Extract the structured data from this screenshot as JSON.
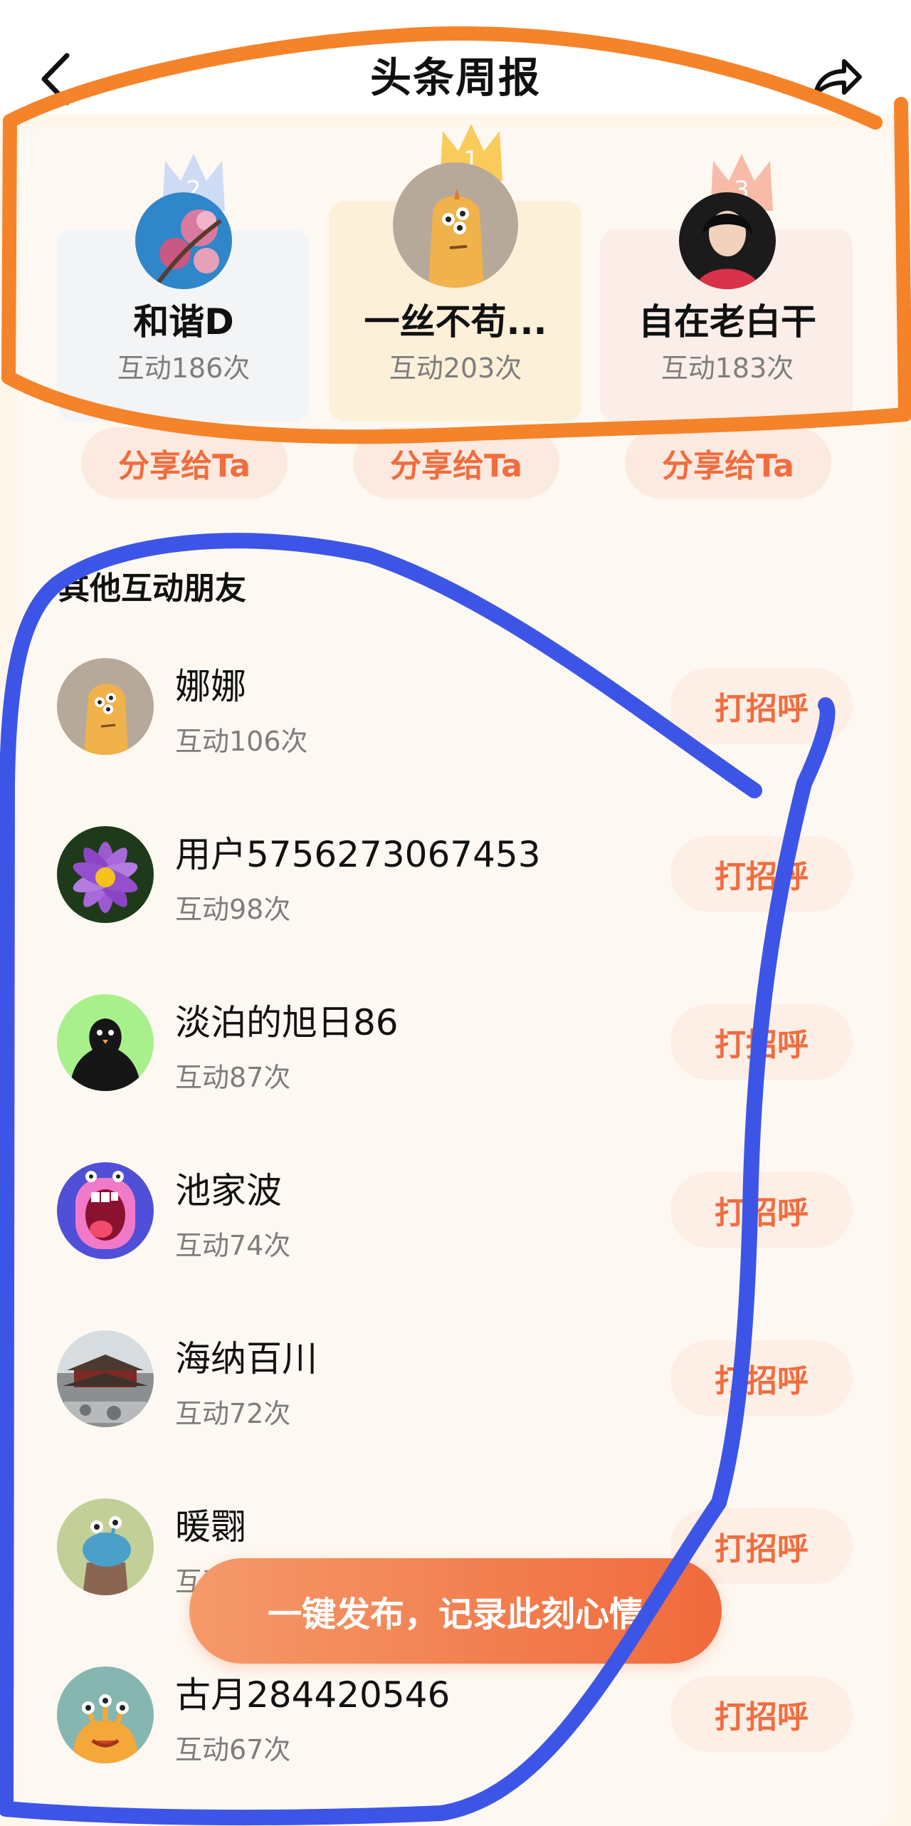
{
  "header": {
    "title": "头条周报",
    "back_icon": "chevron-left-icon",
    "share_icon": "share-arrow-icon"
  },
  "top_friends": [
    {
      "rank": "2",
      "name": "和谐D",
      "count": "互动186次",
      "share_label": "分享给Ta",
      "crown_color": "#b8cdf3"
    },
    {
      "rank": "1",
      "name": "一丝不苟...",
      "count": "互动203次",
      "share_label": "分享给Ta",
      "crown_color": "#f7c54a"
    },
    {
      "rank": "3",
      "name": "自在老白干",
      "count": "互动183次",
      "share_label": "分享给Ta",
      "crown_color": "#f4a890"
    }
  ],
  "section_title": "其他互动朋友",
  "others": [
    {
      "name": "娜娜",
      "count": "互动106次",
      "greet": "打招呼"
    },
    {
      "name": "用户5756273067453",
      "count": "互动98次",
      "greet": "打招呼"
    },
    {
      "name": "淡泊的旭日86",
      "count": "互动87次",
      "greet": "打招呼"
    },
    {
      "name": "池家波",
      "count": "互动74次",
      "greet": "打招呼"
    },
    {
      "name": "海纳百川",
      "count": "互动72次",
      "greet": "打招呼"
    },
    {
      "name": "暖翾",
      "count": "互动70次",
      "greet": "打招呼"
    },
    {
      "name": "古月284420546",
      "count": "互动67次",
      "greet": "打招呼"
    }
  ],
  "publish_button": "一键发布，记录此刻心情",
  "colors": {
    "accent": "#ef6d3e",
    "highlight_orange": "#f5832a",
    "highlight_blue": "#3d55e6"
  }
}
